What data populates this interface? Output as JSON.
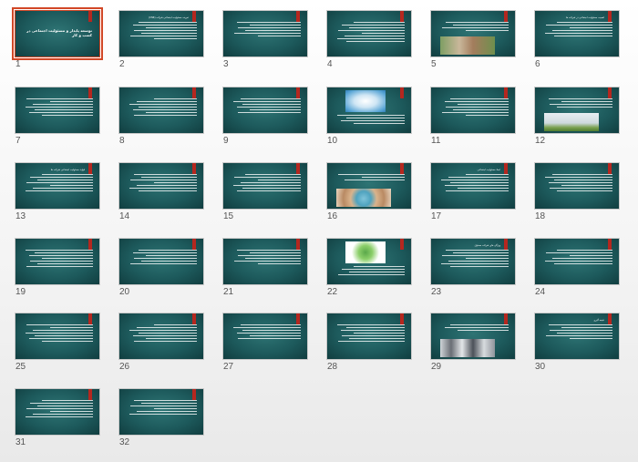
{
  "colors": {
    "selection": "#d24726",
    "accent_tab": "#b5271f",
    "slide_bg": "#1d5a5c"
  },
  "slides": [
    {
      "number": "1",
      "layout": "title",
      "title": "توسعه پایدار و مسئولیت اجتماعی در کسب و کار",
      "selected": true
    },
    {
      "number": "2",
      "layout": "text",
      "heading": "تعریف مسئولیت اجتماعی شرکت (CSR)",
      "lines": 7
    },
    {
      "number": "3",
      "layout": "text",
      "lines": 6
    },
    {
      "number": "4",
      "layout": "text",
      "lines": 8
    },
    {
      "number": "5",
      "layout": "image",
      "image": "hands-plant-photo",
      "lines": 4
    },
    {
      "number": "6",
      "layout": "text",
      "heading": "اهمیت مسئولیت اجتماعی در شرکت ها",
      "lines": 6
    },
    {
      "number": "7",
      "layout": "text",
      "lines": 7
    },
    {
      "number": "8",
      "layout": "text",
      "lines": 7
    },
    {
      "number": "9",
      "layout": "text",
      "lines": 6
    },
    {
      "number": "10",
      "layout": "image-top",
      "image": "csr-cloud-graphic",
      "lines": 4
    },
    {
      "number": "11",
      "layout": "text",
      "lines": 7
    },
    {
      "number": "12",
      "layout": "image",
      "image": "laptop-photo",
      "lines": 4
    },
    {
      "number": "13",
      "layout": "text",
      "heading": "فواید مسئولیت اجتماعی شرکت ها",
      "lines": 7
    },
    {
      "number": "14",
      "layout": "text",
      "lines": 7
    },
    {
      "number": "15",
      "layout": "text",
      "lines": 7
    },
    {
      "number": "16",
      "layout": "image",
      "image": "globe-hands-photo",
      "lines": 3
    },
    {
      "number": "17",
      "layout": "text",
      "heading": "ابعاد مسئولیت اجتماعی",
      "lines": 7
    },
    {
      "number": "18",
      "layout": "text",
      "lines": 7
    },
    {
      "number": "19",
      "layout": "text",
      "lines": 7
    },
    {
      "number": "20",
      "layout": "text",
      "lines": 6
    },
    {
      "number": "21",
      "layout": "text",
      "lines": 6
    },
    {
      "number": "22",
      "layout": "image-top",
      "image": "green-globe-graphic",
      "lines": 4
    },
    {
      "number": "23",
      "layout": "text",
      "heading": "ویژگی های شرکت مسئول",
      "lines": 7
    },
    {
      "number": "24",
      "layout": "text",
      "lines": 6
    },
    {
      "number": "25",
      "layout": "text",
      "lines": 7
    },
    {
      "number": "26",
      "layout": "text",
      "lines": 7
    },
    {
      "number": "27",
      "layout": "text",
      "lines": 6
    },
    {
      "number": "28",
      "layout": "text",
      "lines": 7
    },
    {
      "number": "29",
      "layout": "image",
      "image": "meeting-photo",
      "lines": 3
    },
    {
      "number": "30",
      "layout": "text",
      "heading": "نتیجه گیری",
      "lines": 6
    },
    {
      "number": "31",
      "layout": "text",
      "lines": 7
    },
    {
      "number": "32",
      "layout": "text",
      "lines": 6
    }
  ]
}
